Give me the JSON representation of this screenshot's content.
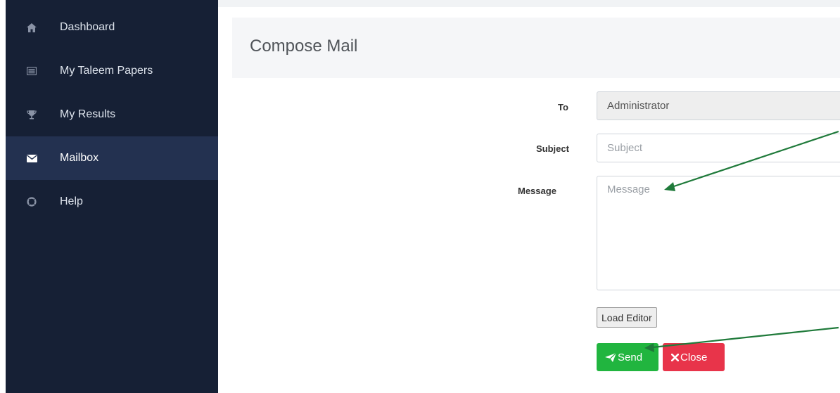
{
  "sidebar": {
    "items": [
      {
        "label": "Dashboard",
        "icon": "home-icon",
        "active": false
      },
      {
        "label": "My Taleem Papers",
        "icon": "list-icon",
        "active": false
      },
      {
        "label": "My Results",
        "icon": "trophy-icon",
        "active": false
      },
      {
        "label": "Mailbox",
        "icon": "envelope-icon",
        "active": true
      },
      {
        "label": "Help",
        "icon": "life-ring-icon",
        "active": false
      }
    ]
  },
  "compose": {
    "title": "Compose Mail",
    "to_label": "To",
    "to_value": "Administrator",
    "subject_label": "Subject",
    "subject_placeholder": "Subject",
    "message_label": "Message",
    "message_placeholder": "Message",
    "load_editor_label": "Load Editor",
    "send_label": "Send",
    "close_label": "Close"
  },
  "colors": {
    "sidebar_bg": "#162035",
    "sidebar_active_bg": "#233150",
    "send_button": "#21b53f",
    "close_button": "#e8344a",
    "annotation_arrow": "#1f7a3a"
  }
}
